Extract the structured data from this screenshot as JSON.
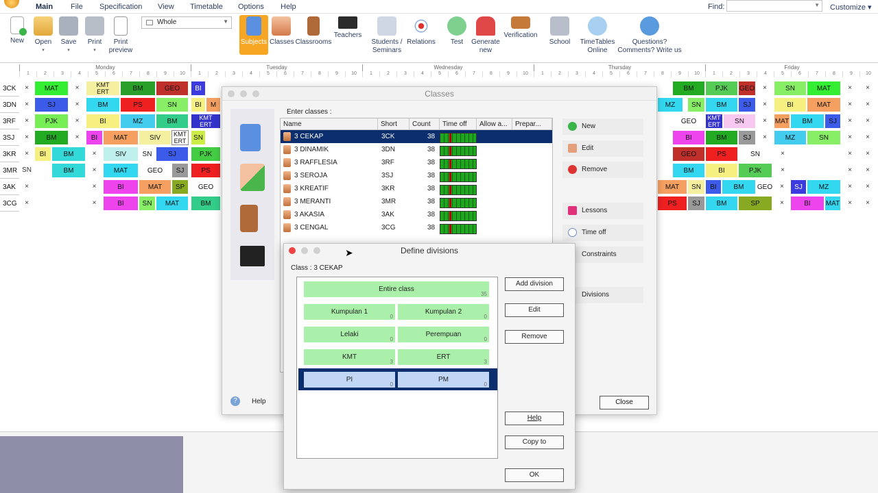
{
  "menu": {
    "items": [
      "Main",
      "File",
      "Specification",
      "View",
      "Timetable",
      "Options",
      "Help"
    ],
    "find_label": "Find:",
    "customize": "Customize"
  },
  "toolbar": {
    "view_value": "Whole",
    "new": "New",
    "open": "Open",
    "save": "Save",
    "print": "Print",
    "print_preview": [
      "Print",
      "preview"
    ],
    "subjects": "Subjects",
    "classes": "Classes",
    "classrooms": "Classrooms",
    "teachers": "Teachers",
    "students": [
      "Students /",
      "Seminars"
    ],
    "relations": "Relations",
    "test": "Test",
    "generate": [
      "Generate",
      "new"
    ],
    "verification": "Verification",
    "school": "School",
    "online": [
      "TimeTables",
      "Online"
    ],
    "questions": [
      "Questions?",
      "Comments? Write us"
    ]
  },
  "timetable": {
    "days": [
      "Monday",
      "Tuesday",
      "Wednesday",
      "Thursday",
      "Friday"
    ],
    "rows": [
      "3CK",
      "3DN",
      "3RF",
      "3SJ",
      "3KR",
      "3MR",
      "3AK",
      "3CG"
    ]
  },
  "classes_dialog": {
    "title": "Classes",
    "enter_label": "Enter classes :",
    "columns": [
      "Name",
      "Short",
      "Count",
      "Time off",
      "Allow a...",
      "Prepar..."
    ],
    "rows": [
      {
        "name": "3 CEKAP",
        "short": "3CK",
        "count": "38"
      },
      {
        "name": "3 DINAMIK",
        "short": "3DN",
        "count": "38"
      },
      {
        "name": "3 RAFFLESIA",
        "short": "3RF",
        "count": "38"
      },
      {
        "name": "3 SEROJA",
        "short": "3SJ",
        "count": "38"
      },
      {
        "name": "3 KREATIF",
        "short": "3KR",
        "count": "38"
      },
      {
        "name": "3 MERANTI",
        "short": "3MR",
        "count": "38"
      },
      {
        "name": "3 AKASIA",
        "short": "3AK",
        "count": "38"
      },
      {
        "name": "3 CENGAL",
        "short": "3CG",
        "count": "38"
      }
    ],
    "actions": [
      "New",
      "Edit",
      "Remove",
      "Lessons",
      "Time off",
      "Constraints",
      "Divisions"
    ],
    "help": "Help",
    "close": "Close"
  },
  "divisions_dialog": {
    "title": "Define divisions",
    "class_label": "Class :   3 CEKAP",
    "entire": {
      "label": "Entire class",
      "count": "35"
    },
    "groups": [
      [
        {
          "label": "Kumpulan 1",
          "count": "0"
        },
        {
          "label": "Kumpulan 2",
          "count": "0"
        }
      ],
      [
        {
          "label": "Lelaki",
          "count": "0"
        },
        {
          "label": "Perempuan",
          "count": "0"
        }
      ],
      [
        {
          "label": "KMT",
          "count": "3"
        },
        {
          "label": "ERT",
          "count": "3"
        }
      ],
      [
        {
          "label": "PI",
          "count": "0"
        },
        {
          "label": "PM",
          "count": "0"
        }
      ]
    ],
    "buttons": {
      "add": "Add division",
      "edit": "Edit",
      "remove": "Remove",
      "help": "Help",
      "copy": "Copy to",
      "ok": "OK"
    }
  },
  "colors": {
    "selected": "#0b2e6f",
    "division_green": "#aaf0aa",
    "division_blue": "#c2d6f6",
    "toolbar_active": "#f6a623"
  }
}
